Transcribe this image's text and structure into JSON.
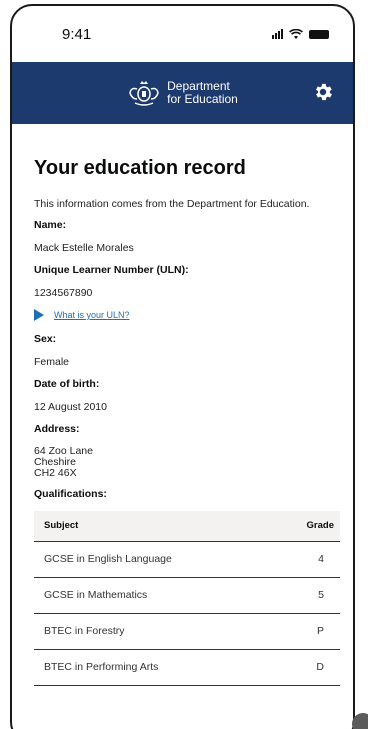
{
  "status_bar": {
    "time": "9:41"
  },
  "header": {
    "logo_line1": "Department",
    "logo_line2": "for Education"
  },
  "page": {
    "title": "Your education record",
    "intro": "This information comes from the Department for Education."
  },
  "fields": {
    "name_label": "Name:",
    "name_value": "Mack Estelle Morales",
    "uln_label": "Unique Learner Number (ULN):",
    "uln_value": "1234567890",
    "uln_link": "What is your ULN?",
    "sex_label": "Sex:",
    "sex_value": "Female",
    "dob_label": "Date of birth:",
    "dob_value": "12 August 2010",
    "address_label": "Address:",
    "address_lines": [
      "64 Zoo Lane",
      "Cheshire",
      "CH2 46X"
    ],
    "qualifications_label": "Qualifications:"
  },
  "table": {
    "headers": {
      "subject": "Subject",
      "grade": "Grade"
    },
    "rows": [
      {
        "subject": "GCSE in English Language",
        "grade": "4"
      },
      {
        "subject": "GCSE in Mathematics",
        "grade": "5"
      },
      {
        "subject": "BTEC in Forestry",
        "grade": "P"
      },
      {
        "subject": "BTEC in Performing Arts",
        "grade": "D"
      }
    ]
  },
  "icons": {
    "settings": "gear-icon",
    "expand": "triangle-right-icon"
  },
  "colors": {
    "header_bg": "#1d3a6e",
    "link": "#1d70b8",
    "table_header_bg": "#f3f2f1"
  }
}
